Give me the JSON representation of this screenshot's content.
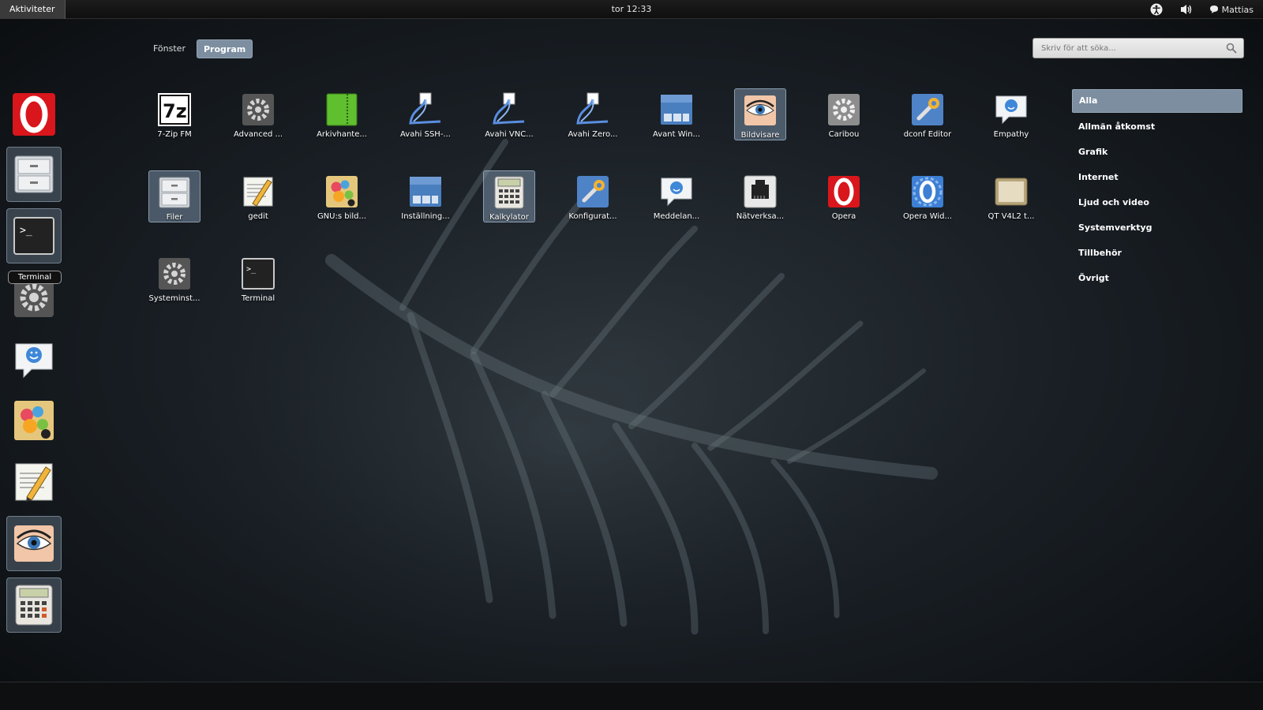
{
  "topbar": {
    "activities_label": "Aktiviteter",
    "clock": "tor 12:33",
    "user_name": "Mattias",
    "icons": [
      "accessibility-icon",
      "volume-icon",
      "chat-status-icon"
    ]
  },
  "view_tabs": [
    {
      "label": "Fönster",
      "active": false
    },
    {
      "label": "Program",
      "active": true
    }
  ],
  "search": {
    "placeholder": "Skriv för att söka..."
  },
  "dash": {
    "tooltip": "Terminal",
    "items": [
      "opera-icon",
      "files-icon",
      "terminal-icon",
      "system-settings-icon",
      "empathy-icon",
      "gimp-icon",
      "gedit-icon",
      "image-viewer-icon",
      "calculator-icon"
    ]
  },
  "apps": [
    {
      "label": "7-Zip FM",
      "icon": "7zip-icon",
      "selected": false
    },
    {
      "label": "Advanced ...",
      "icon": "advanced-settings-icon",
      "selected": false
    },
    {
      "label": "Arkivhante...",
      "icon": "archive-manager-icon",
      "selected": false
    },
    {
      "label": "Avahi SSH-...",
      "icon": "avahi-ssh-icon",
      "selected": false
    },
    {
      "label": "Avahi VNC...",
      "icon": "avahi-vnc-icon",
      "selected": false
    },
    {
      "label": "Avahi Zero...",
      "icon": "avahi-zeroconf-icon",
      "selected": false
    },
    {
      "label": "Avant Win...",
      "icon": "avant-window-icon",
      "selected": false
    },
    {
      "label": "Bildvisare",
      "icon": "image-viewer-icon",
      "selected": true
    },
    {
      "label": "Caribou",
      "icon": "caribou-gear-icon",
      "selected": false
    },
    {
      "label": "dconf Editor",
      "icon": "dconf-editor-icon",
      "selected": false
    },
    {
      "label": "Empathy",
      "icon": "empathy-icon",
      "selected": false
    },
    {
      "label": "Filer",
      "icon": "files-icon",
      "selected": true
    },
    {
      "label": "gedit",
      "icon": "gedit-icon",
      "selected": false
    },
    {
      "label": "GNU:s bild...",
      "icon": "gimp-icon",
      "selected": false
    },
    {
      "label": "Inställning...",
      "icon": "settings-window-icon",
      "selected": false
    },
    {
      "label": "Kalkylator",
      "icon": "calculator-icon",
      "selected": true
    },
    {
      "label": "Konfigurat...",
      "icon": "configuration-icon",
      "selected": false
    },
    {
      "label": "Meddelan...",
      "icon": "messaging-icon",
      "selected": false
    },
    {
      "label": "Nätverksa...",
      "icon": "network-icon",
      "selected": false
    },
    {
      "label": "Opera",
      "icon": "opera-icon",
      "selected": false
    },
    {
      "label": "Opera Wid...",
      "icon": "opera-widgets-icon",
      "selected": false
    },
    {
      "label": "QT V4L2 t...",
      "icon": "qt-v4l2-icon",
      "selected": false
    },
    {
      "label": "Systeminst...",
      "icon": "system-settings-icon",
      "selected": false
    },
    {
      "label": "Terminal",
      "icon": "terminal-icon",
      "selected": false
    }
  ],
  "categories": [
    {
      "label": "Alla",
      "active": true
    },
    {
      "label": "Allmän åtkomst",
      "active": false
    },
    {
      "label": "Grafik",
      "active": false
    },
    {
      "label": "Internet",
      "active": false
    },
    {
      "label": "Ljud och video",
      "active": false
    },
    {
      "label": "Systemverktyg",
      "active": false
    },
    {
      "label": "Tillbehör",
      "active": false
    },
    {
      "label": "Övrigt",
      "active": false
    }
  ],
  "colors": {
    "accent": "#7c8ea0",
    "topbar": "#141414",
    "background": "#1a2026"
  }
}
